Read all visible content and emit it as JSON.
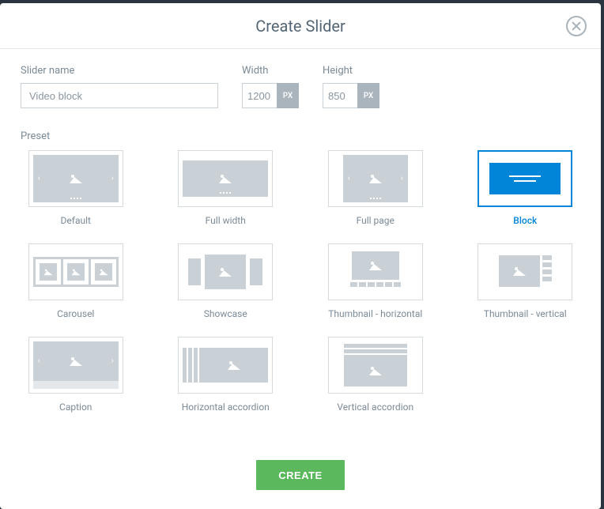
{
  "modal": {
    "title": "Create Slider",
    "close_icon": "close"
  },
  "form": {
    "name_label": "Slider name",
    "name_value": "Video block",
    "width_label": "Width",
    "width_value": "1200",
    "width_unit": "PX",
    "height_label": "Height",
    "height_value": "850",
    "height_unit": "PX"
  },
  "preset": {
    "label": "Preset",
    "selected": "block",
    "items": [
      {
        "id": "default",
        "label": "Default"
      },
      {
        "id": "fullwidth",
        "label": "Full width"
      },
      {
        "id": "fullpage",
        "label": "Full page"
      },
      {
        "id": "block",
        "label": "Block"
      },
      {
        "id": "carousel",
        "label": "Carousel"
      },
      {
        "id": "showcase",
        "label": "Showcase"
      },
      {
        "id": "thumbh",
        "label": "Thumbnail - horizontal"
      },
      {
        "id": "thumbv",
        "label": "Thumbnail - vertical"
      },
      {
        "id": "caption",
        "label": "Caption"
      },
      {
        "id": "hacc",
        "label": "Horizontal accordion"
      },
      {
        "id": "vacc",
        "label": "Vertical accordion"
      }
    ]
  },
  "actions": {
    "create_label": "CREATE"
  },
  "colors": {
    "accent": "#0085d8",
    "success": "#5cb85c",
    "muted": "#c9d0d6",
    "text": "#7b8a97"
  }
}
